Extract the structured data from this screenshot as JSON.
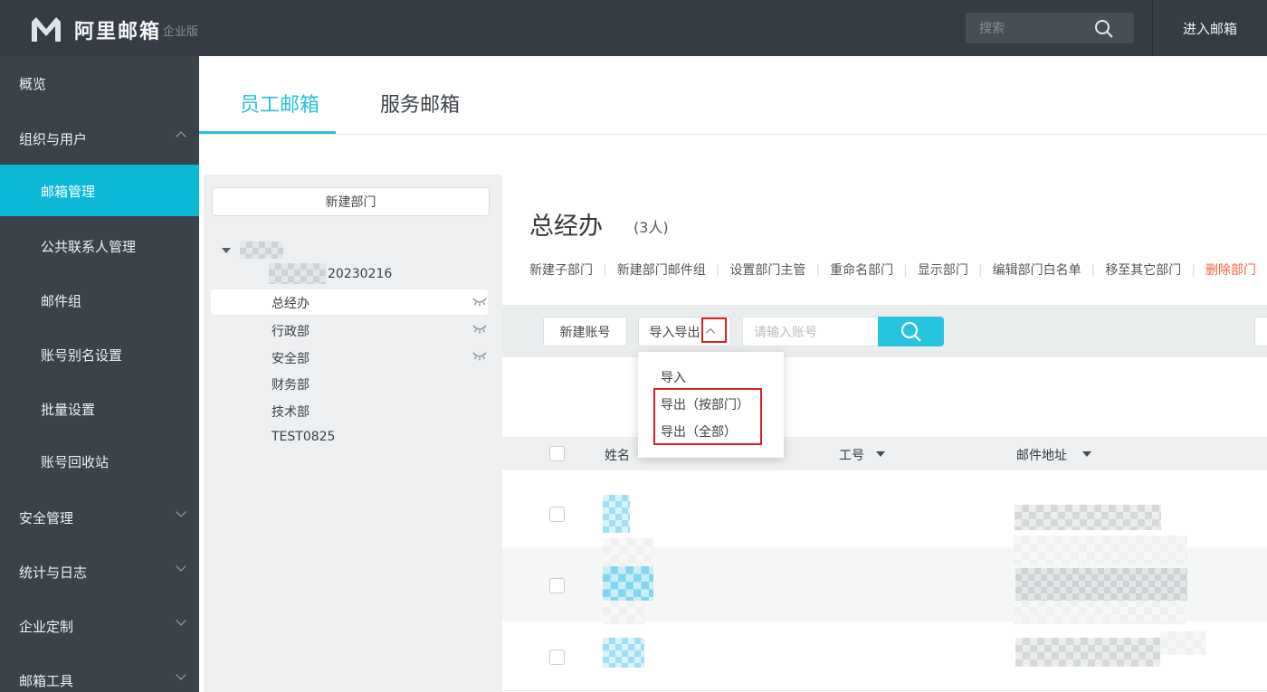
{
  "colors": {
    "accent": "#0bb8d5",
    "tab_accent": "#2ac0dc",
    "danger": "#f25f3f",
    "annotation_red": "#e01f1f",
    "topbar_bg": "#353c43",
    "sidebar_bg": "#3a424a"
  },
  "topbar": {
    "brand": "阿里邮箱",
    "edition": "企业版",
    "search_placeholder": "搜索",
    "enter_mailbox_label": "进入邮箱"
  },
  "sidebar": {
    "items": [
      {
        "label": "概览",
        "level": "top"
      },
      {
        "label": "组织与用户",
        "level": "top",
        "expanded": true
      },
      {
        "label": "邮箱管理",
        "level": "sub",
        "active": true
      },
      {
        "label": "公共联系人管理",
        "level": "sub"
      },
      {
        "label": "邮件组",
        "level": "sub"
      },
      {
        "label": "账号别名设置",
        "level": "sub"
      },
      {
        "label": "批量设置",
        "level": "sub"
      },
      {
        "label": "账号回收站",
        "level": "sub"
      },
      {
        "label": "安全管理",
        "level": "top",
        "expanded": false
      },
      {
        "label": "统计与日志",
        "level": "top",
        "expanded": false
      },
      {
        "label": "企业定制",
        "level": "top",
        "expanded": false
      },
      {
        "label": "邮箱工具",
        "level": "top",
        "expanded": false
      }
    ]
  },
  "tabs": {
    "items": [
      {
        "label": "员工邮箱",
        "active": true
      },
      {
        "label": "服务邮箱",
        "active": false
      }
    ]
  },
  "dept_panel": {
    "new_dept_button": "新建部门",
    "tree": {
      "root": {
        "redacted": true
      },
      "items": [
        {
          "label": "20230216",
          "redacted_prefix": true
        },
        {
          "label": "总经办",
          "selected": true,
          "hidden_dept_icon": true
        },
        {
          "label": "行政部",
          "hidden_dept_icon": true
        },
        {
          "label": "安全部",
          "hidden_dept_icon": true
        },
        {
          "label": "财务部"
        },
        {
          "label": "技术部"
        },
        {
          "label": "TEST0825"
        }
      ]
    }
  },
  "dept_header": {
    "title": "总经办",
    "count": "(3人)",
    "actions": [
      "新建子部门",
      "新建部门邮件组",
      "设置部门主管",
      "重命名部门",
      "显示部门",
      "编辑部门白名单",
      "移至其它部门",
      "删除部门"
    ]
  },
  "toolbar": {
    "new_account_label": "新建账号",
    "import_export_label": "导入导出",
    "search_placeholder": "请输入账号"
  },
  "dropdown": {
    "items": [
      "导入",
      "导出（按部门）",
      "导出（全部）"
    ]
  },
  "table": {
    "columns": [
      {
        "label": "姓名",
        "sortable": false
      },
      {
        "label": "工号",
        "sortable": true
      },
      {
        "label": "邮件地址",
        "sortable": true
      }
    ],
    "rows": [
      {
        "name_redacted": true,
        "email_redacted": true
      },
      {
        "name_redacted": true,
        "email_redacted": true
      },
      {
        "name_redacted": true,
        "email_redacted": true
      }
    ]
  }
}
